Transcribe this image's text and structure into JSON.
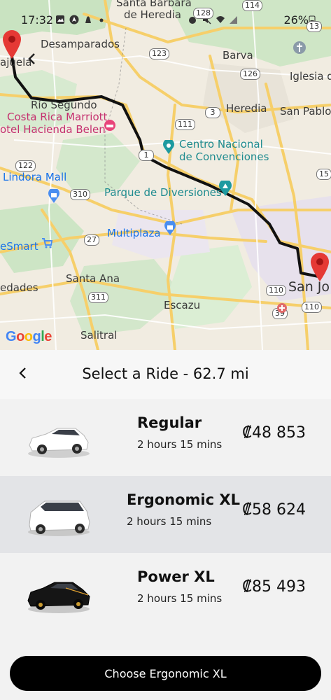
{
  "status_bar": {
    "time": "17:32",
    "battery": "26%"
  },
  "map": {
    "labels": {
      "santa_barbara": "Santa Barbara",
      "de_heredia": "de Heredia",
      "desamparados": "Desamparados",
      "barva": "Barva",
      "iglesia": "Iglesia d",
      "alajuela": "ajuela",
      "rio_segundo": "Río Segundo",
      "costa_rica_marriott": "Costa Rica Marriott",
      "hotel_hacienda_belen": "otel Hacienda Belen",
      "heredia": "Heredia",
      "san_pablo": "San Pablo",
      "centro_nacional": "Centro Nacional",
      "de_convenciones": "de Convenciones",
      "lindora_mall": "Lindora Mall",
      "parque_diversiones": "Parque de Diversiones",
      "multiplaza": "Multiplaza",
      "esmart": "eSmart",
      "santa_ana": "Santa Ana",
      "edades": "edades",
      "escazu": "Escazu",
      "salitral": "Salitral",
      "san_jose": "San Jo"
    },
    "shields": {
      "s114": "114",
      "s128": "128",
      "s13": "13",
      "s123": "123",
      "s126": "126",
      "s3": "3",
      "s111": "111",
      "s1": "1",
      "s122": "122",
      "s310": "310",
      "s27": "27",
      "s311": "311",
      "s110a": "110",
      "s110b": "110",
      "s39": "39",
      "s15": "15"
    },
    "google_logo": [
      "G",
      "o",
      "o",
      "g",
      "l",
      "e"
    ]
  },
  "sheet": {
    "title": "Select a Ride - 62.7 mi",
    "rides": [
      {
        "name": "Regular",
        "duration": "2 hours 15 mins",
        "price": "₡48 853",
        "car_color": "#ffffff",
        "selected": false
      },
      {
        "name": "Ergonomic XL",
        "duration": "2 hours 15 mins",
        "price": "₡58 624",
        "car_color": "#ffffff",
        "selected": true
      },
      {
        "name": "Power XL",
        "duration": "2 hours 15 mins",
        "price": "₡85 493",
        "car_color": "#111111",
        "selected": false
      }
    ],
    "choose_button_label": "Choose Ergonomic XL"
  },
  "colors": {
    "route": "#111111",
    "pin": "#e53935",
    "selected_row": "#e3e4e7",
    "button": "#000000"
  }
}
